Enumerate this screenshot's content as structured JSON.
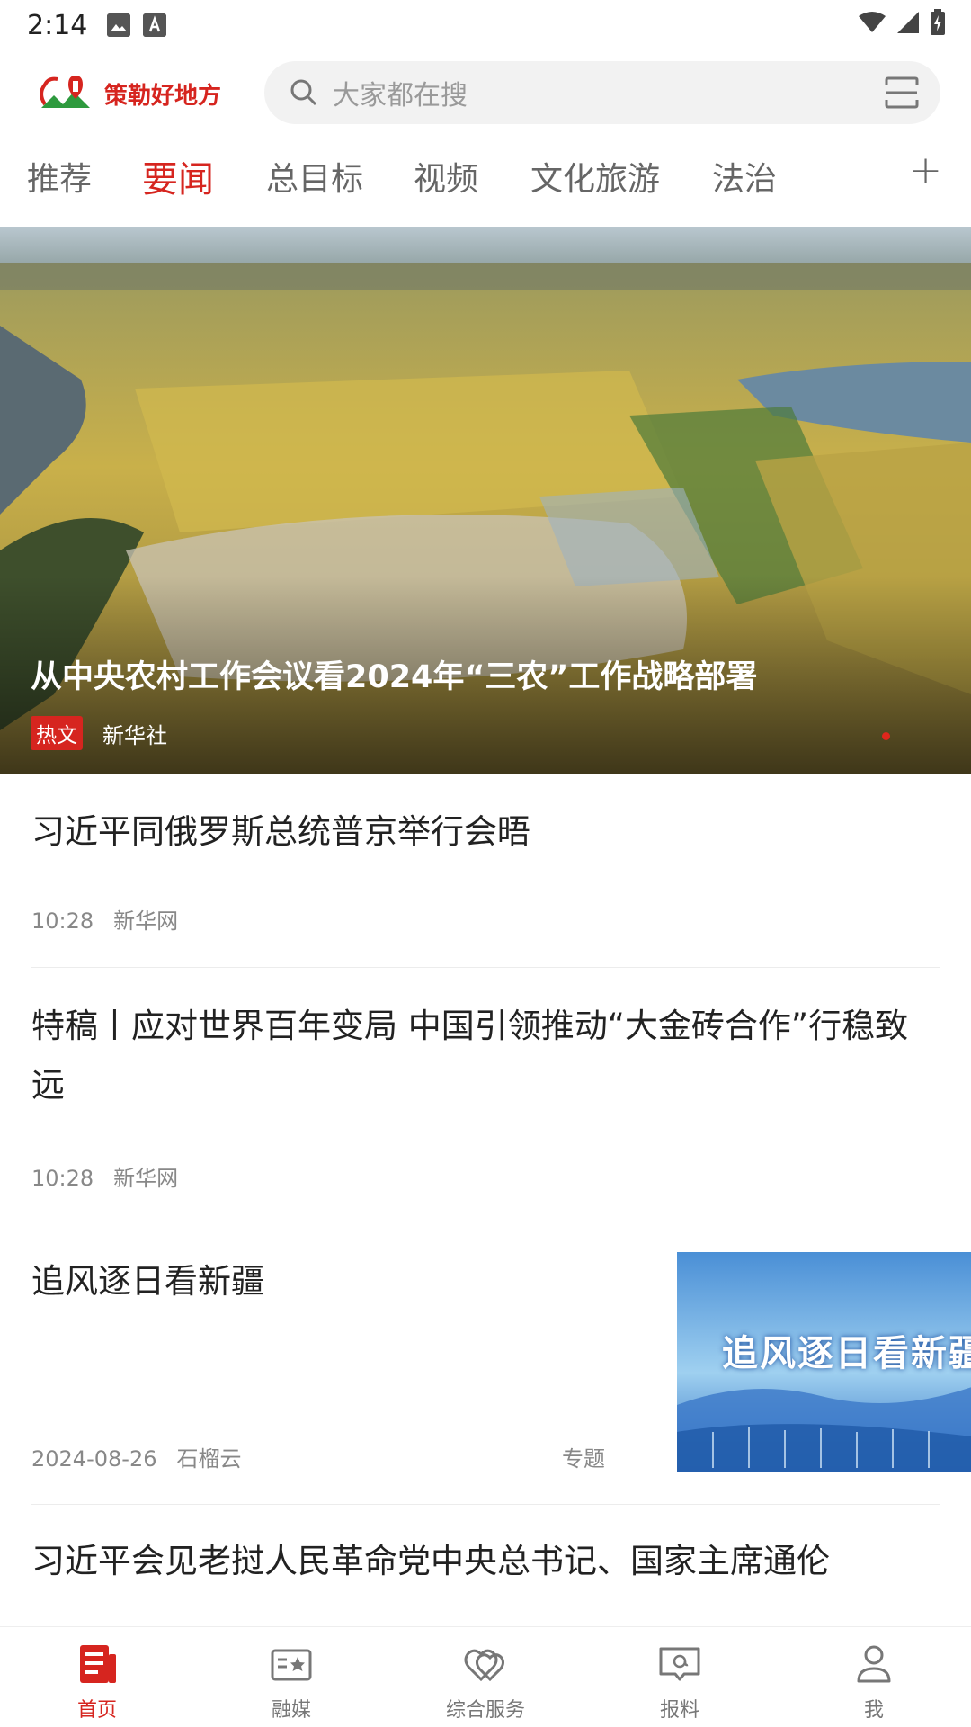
{
  "status_bar": {
    "time": "2:14"
  },
  "header": {
    "logo_text": "策勒好地方",
    "search_placeholder": "大家都在搜"
  },
  "tabs": [
    {
      "label": "推荐",
      "active": false
    },
    {
      "label": "要闻",
      "active": true
    },
    {
      "label": "总目标",
      "active": false
    },
    {
      "label": "视频",
      "active": false
    },
    {
      "label": "文化旅游",
      "active": false
    },
    {
      "label": "法治",
      "active": false
    }
  ],
  "tab_more_label": "+",
  "banner": {
    "title": "从中央农村工作会议看2024年“三农”工作战略部署",
    "tag": "热文",
    "source": "新华社"
  },
  "news": [
    {
      "title": "习近平同俄罗斯总统普京举行会晤",
      "time": "10:28",
      "source": "新华网"
    },
    {
      "title": "特稿丨应对世界百年变局 中国引领推动“大金砖合作”行稳致远",
      "time": "10:28",
      "source": "新华网"
    },
    {
      "title": "追风逐日看新疆",
      "time": "2024-08-26",
      "source": "石榴云",
      "tag": "专题",
      "thumb_text": "追风逐日看新疆"
    },
    {
      "title": "习近平会见老挝人民革命党中央总书记、国家主席通伦"
    }
  ],
  "bottom_nav": [
    {
      "label": "首页",
      "icon": "news-icon",
      "active": true
    },
    {
      "label": "融媒",
      "icon": "media-card-icon",
      "active": false
    },
    {
      "label": "综合服务",
      "icon": "hearts-icon",
      "active": false
    },
    {
      "label": "报料",
      "icon": "report-chat-icon",
      "active": false
    },
    {
      "label": "我",
      "icon": "user-icon",
      "active": false
    }
  ],
  "colors": {
    "accent": "#d6251f",
    "text": "#222222",
    "meta": "#888888"
  }
}
